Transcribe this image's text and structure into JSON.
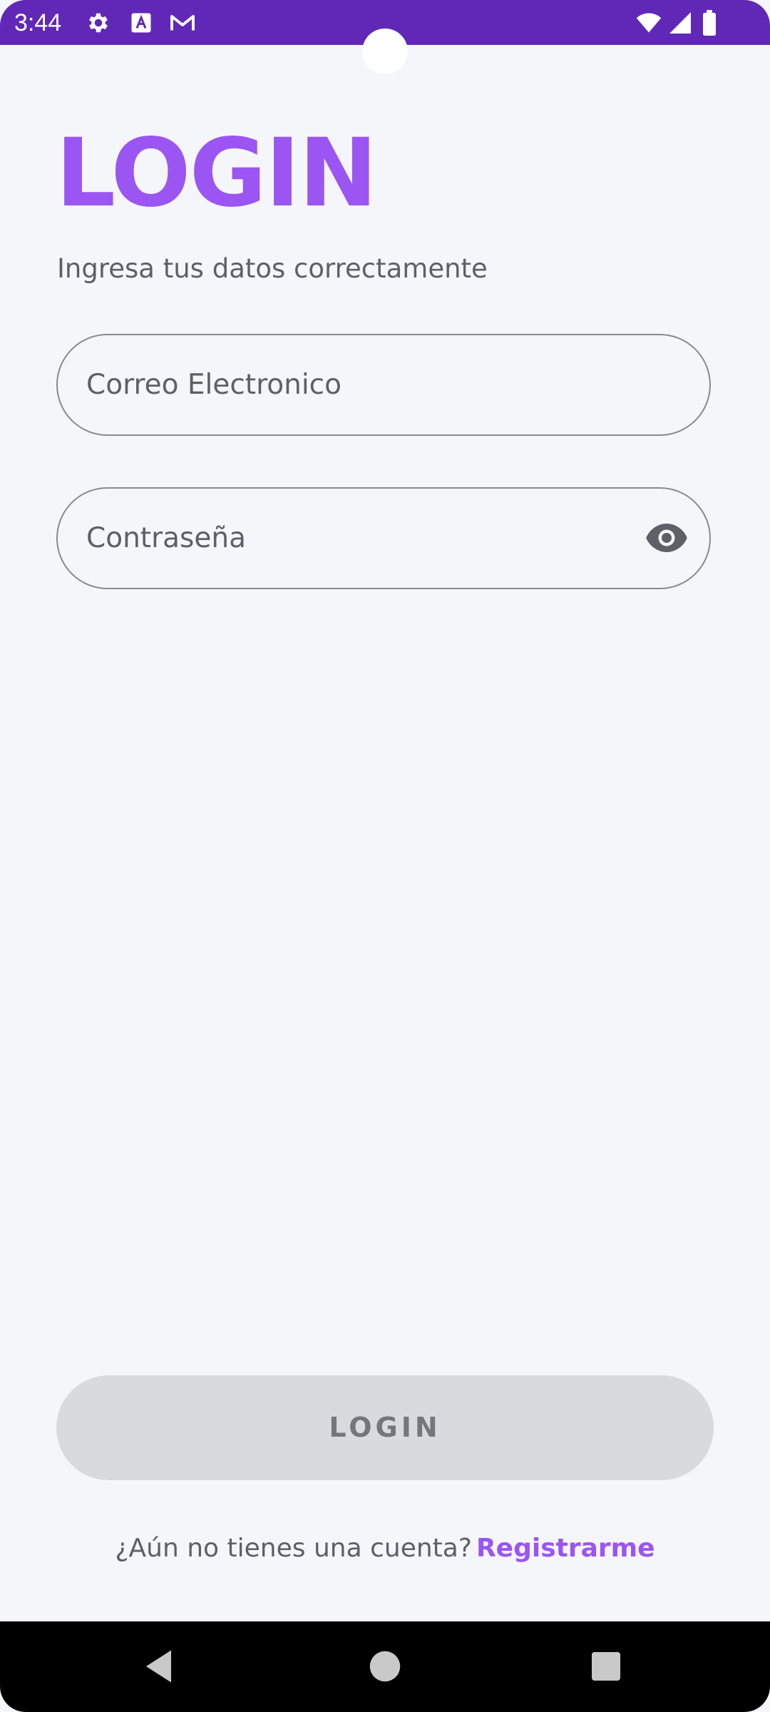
{
  "status_bar": {
    "time": "3:44",
    "icons_left": [
      "settings-icon",
      "font-icon",
      "gmail-icon"
    ],
    "icons_right": [
      "wifi-icon",
      "signal-icon",
      "battery-icon"
    ],
    "color": "#6128b8"
  },
  "login": {
    "title": "LOGIN",
    "subtitle": "Ingresa tus datos correctamente",
    "email_placeholder": "Correo Electronico",
    "email_value": "",
    "password_placeholder": "Contraseña",
    "password_value": "",
    "button_label": "LOGIN",
    "accent_color": "#9b55f3"
  },
  "footer": {
    "prompt": "¿Aún no tienes una cuenta?",
    "register_label": "Registrarme"
  },
  "nav_bar": {
    "buttons": [
      "back-icon",
      "home-icon",
      "recents-icon"
    ]
  }
}
